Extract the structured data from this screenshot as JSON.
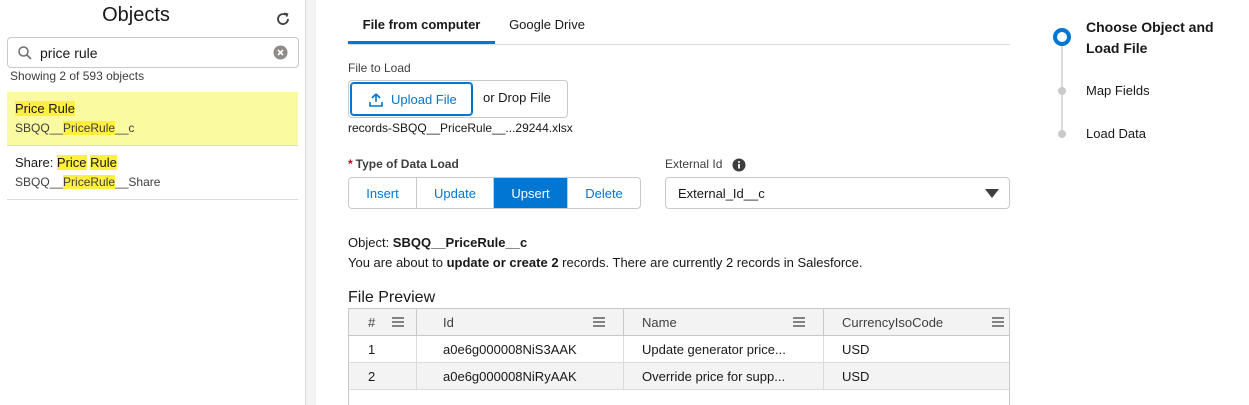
{
  "objects_panel": {
    "title": "Objects",
    "search": {
      "value": "price rule",
      "placeholder": ""
    },
    "count_text": "Showing 2 of 593 objects",
    "items": [
      {
        "name_parts": [
          "Price Rule"
        ],
        "api_prefix": "SBQQ__",
        "api_highlight": "PriceRule",
        "api_suffix": "__c"
      },
      {
        "name_prefix": "Share: ",
        "name_parts": [
          "Price",
          "Rule"
        ],
        "api_prefix": "SBQQ__",
        "api_highlight": "PriceRule",
        "api_suffix": "__Share"
      }
    ]
  },
  "tabs": [
    {
      "label": "File from computer",
      "active": true
    },
    {
      "label": "Google Drive",
      "active": false
    }
  ],
  "file_to_load": {
    "label": "File to Load",
    "upload_button": "Upload File",
    "drop_text": "or Drop File",
    "file_name": "records-SBQQ__PriceRule__...29244.xlsx"
  },
  "data_load_type": {
    "label": "Type of Data Load",
    "required_mark": "*",
    "options": [
      "Insert",
      "Update",
      "Upsert",
      "Delete"
    ],
    "selected": "Upsert"
  },
  "external_id": {
    "label": "External Id",
    "value": "External_Id__c"
  },
  "object_info": {
    "object_prefix": "Object: ",
    "object_name": "SBQQ__PriceRule__c",
    "summary_prefix": "You are about to ",
    "summary_bold": "update or create 2",
    "summary_suffix": " records. There are currently 2 records in Salesforce."
  },
  "preview": {
    "title": "File Preview",
    "columns": [
      "#",
      "Id",
      "Name",
      "CurrencyIsoCode"
    ],
    "rows": [
      [
        "1",
        "a0e6g000008NiS3AAK",
        "Update generator price...",
        "USD"
      ],
      [
        "2",
        "a0e6g000008NiRyAAK",
        "Override price for supp...",
        "USD"
      ]
    ]
  },
  "steps": [
    {
      "label": "Choose Object and Load File",
      "active": true
    },
    {
      "label": "Map Fields",
      "active": false
    },
    {
      "label": "Load Data",
      "active": false
    }
  ],
  "colors": {
    "brand": "#0176d3",
    "highlight": "#fff03f",
    "selected_row": "#fafaa0"
  }
}
